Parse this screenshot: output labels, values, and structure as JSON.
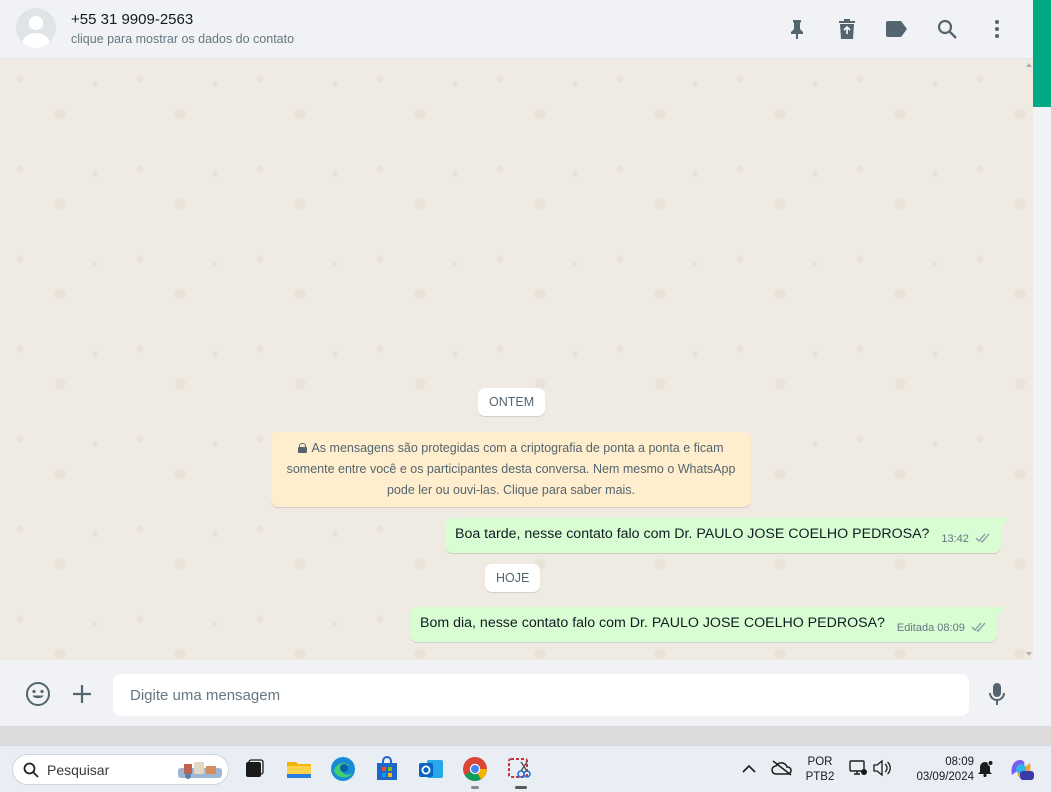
{
  "header": {
    "contact_name": "+55 31 9909-2563",
    "contact_subtitle": "clique para mostrar os dados do contato",
    "icons": [
      "pin-icon",
      "delete-icon",
      "label-icon",
      "search-icon",
      "menu-icon"
    ]
  },
  "chat": {
    "date_yesterday": "ONTEM",
    "date_today": "HOJE",
    "encryption_notice": "As mensagens são protegidas com a criptografia de ponta a ponta e ficam somente entre você e os participantes desta conversa. Nem mesmo o WhatsApp pode ler ou ouvi-las. Clique para saber mais.",
    "messages": [
      {
        "text": "Boa tarde, nesse contato falo com Dr. PAULO JOSE COELHO PEDROSA?",
        "time": "13:42",
        "edited_label": ""
      },
      {
        "text": "Bom dia, nesse contato falo com Dr. PAULO JOSE COELHO PEDROSA?",
        "time": "08:09",
        "edited_label": "Editada"
      }
    ]
  },
  "footer": {
    "placeholder": "Digite uma mensagem"
  },
  "taskbar": {
    "search_label": "Pesquisar",
    "lang_line1": "POR",
    "lang_line2": "PTB2",
    "time": "08:09",
    "date": "03/09/2024"
  },
  "colors": {
    "accent": "#00a884",
    "outgoing_bubble": "#d9fdd3",
    "system_bubble": "#ffeecd",
    "chat_bg": "#efeae2"
  }
}
